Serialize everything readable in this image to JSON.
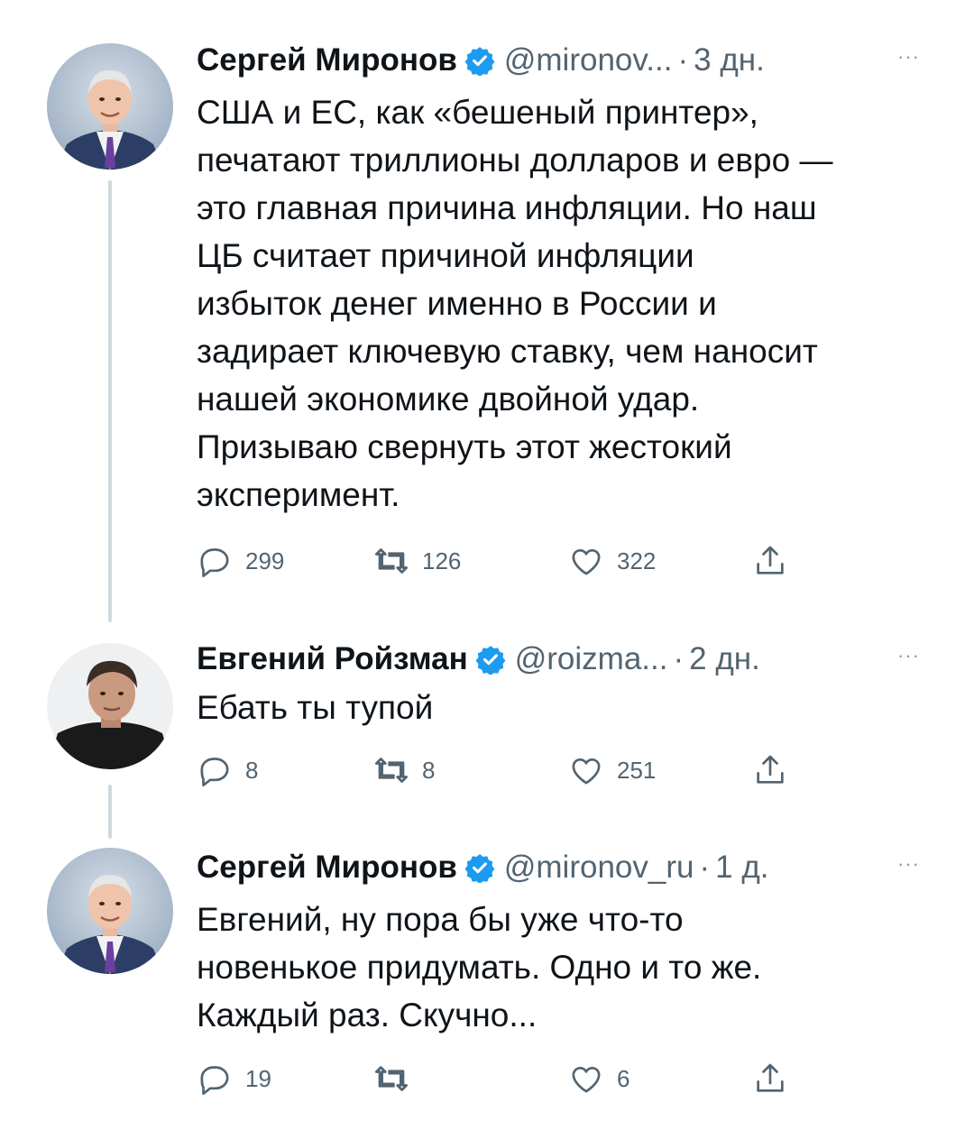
{
  "tweets": [
    {
      "name": "Сергей Миронов",
      "handle": "@mironov...",
      "dot": "·",
      "time": "3 дн.",
      "more": "···",
      "text": "США и ЕС, как «бешеный принтер»,\nпечатают триллионы долларов и евро —\nэто главная причина инфляции. Но наш\nЦБ считает причиной инфляции\nизбыток денег именно в России и\nзадирает ключевую ставку, чем наносит\nнашей экономике двойной удар.\nПризываю свернуть этот жестокий\nэксперимент.",
      "replies": "299",
      "retweets": "126",
      "likes": "322"
    },
    {
      "name": "Евгений Ройзман",
      "handle": "@roizma...",
      "dot": "·",
      "time": "2 дн.",
      "more": "···",
      "text": "Ебать ты тупой",
      "replies": "8",
      "retweets": "8",
      "likes": "251"
    },
    {
      "name": "Сергей Миронов",
      "handle": "@mironov_ru",
      "dot": "·",
      "time": "1 д.",
      "more": "···",
      "text": "Евгений, ну пора бы уже что-то\nновенькое придумать. Одно и то же.\nКаждый раз. Скучно...",
      "replies": "19",
      "retweets": "",
      "likes": "6"
    }
  ],
  "colors": {
    "text": "#0f1419",
    "secondary": "#536471",
    "verified": "#1d9bf0",
    "thread_line": "#cfd9de"
  },
  "icons": [
    "verified-badge-icon",
    "reply-icon",
    "retweet-icon",
    "like-icon",
    "share-icon",
    "more-icon"
  ]
}
